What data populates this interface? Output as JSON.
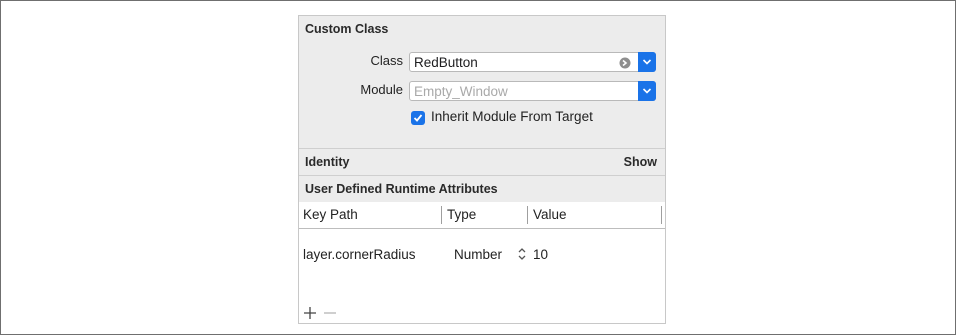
{
  "custom_class": {
    "title": "Custom Class",
    "class_label": "Class",
    "class_value": "RedButton",
    "module_label": "Module",
    "module_placeholder": "Empty_Window",
    "inherit_checked": true,
    "inherit_label": "Inherit Module From Target"
  },
  "identity": {
    "title": "Identity",
    "show_label": "Show"
  },
  "runtime_attributes": {
    "title": "User Defined Runtime Attributes",
    "columns": [
      "Key Path",
      "Type",
      "Value"
    ],
    "rows": [
      {
        "key_path": "layer.cornerRadius",
        "type": "Number",
        "value": "10"
      }
    ]
  },
  "icons": {
    "add": "plus-icon",
    "remove": "minus-icon",
    "goto": "arrow-circle-icon",
    "dropdown": "chevron-down-icon",
    "stepper": "up-down-stepper-icon"
  },
  "colors": {
    "accent": "#1a73e8",
    "panel_bg": "#ececec"
  }
}
